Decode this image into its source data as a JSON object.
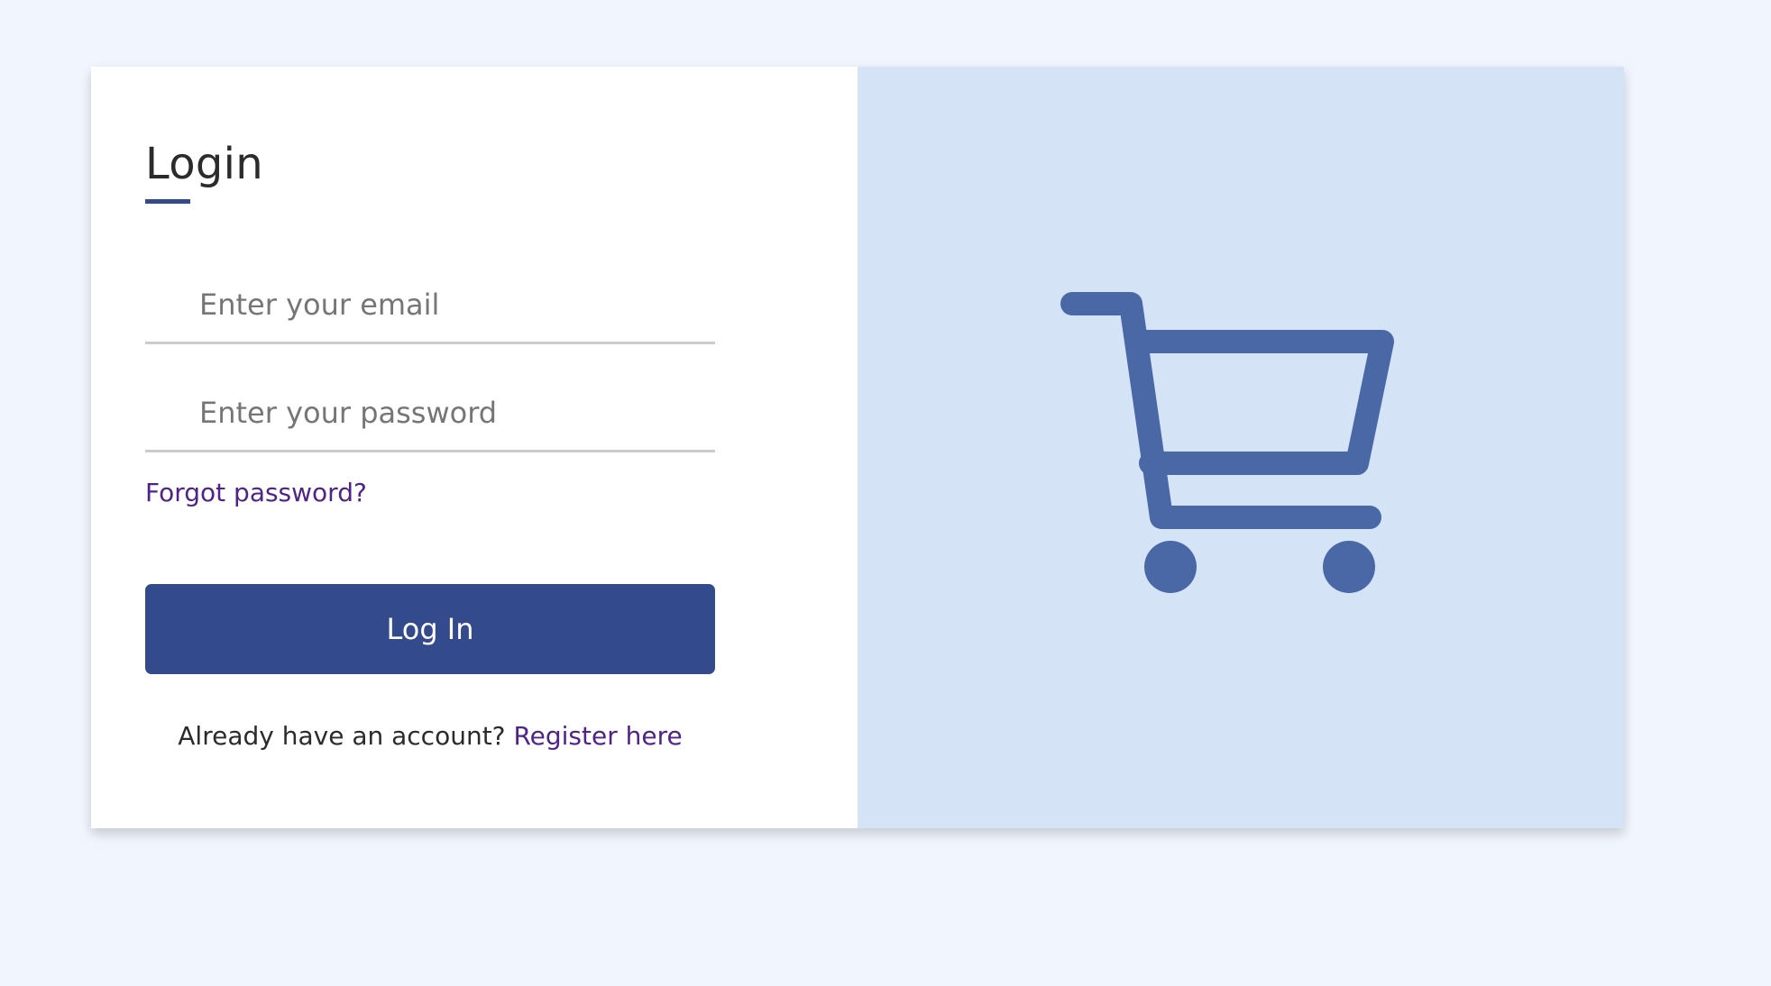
{
  "login": {
    "title": "Login",
    "email_placeholder": "Enter your email",
    "password_placeholder": "Enter your password",
    "forgot_link": "Forgot password?",
    "submit_label": "Log In",
    "register_prompt": "Already have an account?",
    "register_link": "Register here"
  },
  "illustration": {
    "icon": "shopping-cart-icon"
  },
  "colors": {
    "page_background": "#f1f5fe",
    "panel_background": "#d4e3f6",
    "accent": "#334b8d",
    "link": "#4f2389",
    "cart_icon": "#4a68a6"
  }
}
